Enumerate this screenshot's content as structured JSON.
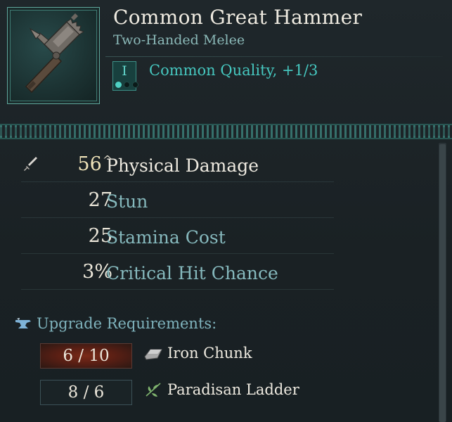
{
  "item": {
    "name": "Common Great Hammer",
    "type": "Two-Handed Melee",
    "tier_numeral": "I",
    "tier_pips_filled": 1,
    "tier_pips_total": 3,
    "quality": "Common Quality, +1/3",
    "icon": "great-hammer-icon"
  },
  "stats": [
    {
      "value": "56",
      "suffix": "^",
      "label": "Physical Damage",
      "icon": "sword-icon"
    },
    {
      "value": "27",
      "label": "Stun"
    },
    {
      "value": "25",
      "label": "Stamina Cost"
    },
    {
      "value": "3%",
      "label": "Critical Hit Chance"
    }
  ],
  "upgrade": {
    "title": "Upgrade Requirements:",
    "icon": "anvil-icon",
    "materials": [
      {
        "count": "6 / 10",
        "name": "Iron Chunk",
        "icon": "iron-chunk-icon",
        "insufficient": true
      },
      {
        "count": "8 / 6",
        "name": "Paradisan Ladder",
        "icon": "leaf-icon",
        "insufficient": false
      }
    ]
  },
  "colors": {
    "background": "#1b2226",
    "accent_teal": "#46c7bf",
    "insufficient_red": "#7a2a18",
    "highlight_value": "#efe3b9"
  }
}
